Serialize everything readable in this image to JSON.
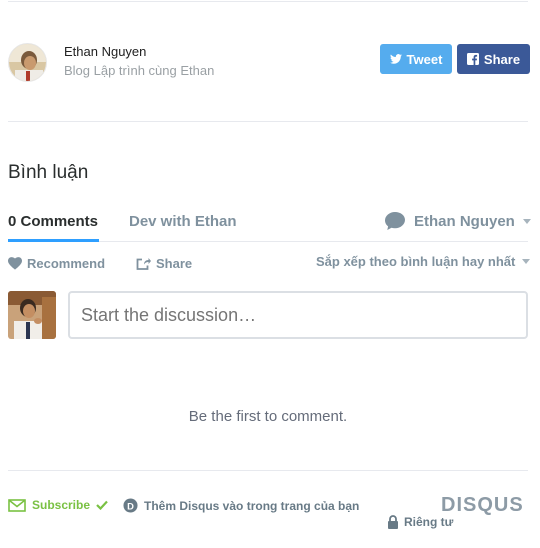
{
  "author": {
    "name": "Ethan Nguyen",
    "blog": "Blog Lập trình cùng Ethan"
  },
  "share_buttons": {
    "tweet_label": "Tweet",
    "facebook_label": "Share"
  },
  "section_title": "Bình luận",
  "tabs": {
    "comments_label": "0 Comments",
    "community_label": "Dev with Ethan",
    "user_label": "Ethan Nguyen"
  },
  "toolbar": {
    "recommend_label": "Recommend",
    "share_label": "Share",
    "sort_label": "Sắp xếp theo bình luận hay nhất"
  },
  "composer": {
    "placeholder": "Start the discussion…"
  },
  "empty_message": "Be the first to comment.",
  "footer": {
    "subscribe_label": "Subscribe",
    "add_disqus_label": "Thêm Disqus vào trong trang của bạn",
    "logo_text": "DISQUS",
    "privacy_label": "Riêng tư"
  },
  "colors": {
    "twitter": "#55acee",
    "facebook": "#3b5998",
    "accent": "#2e9fff",
    "subscribe": "#7ac143",
    "muted": "#7f919e"
  }
}
